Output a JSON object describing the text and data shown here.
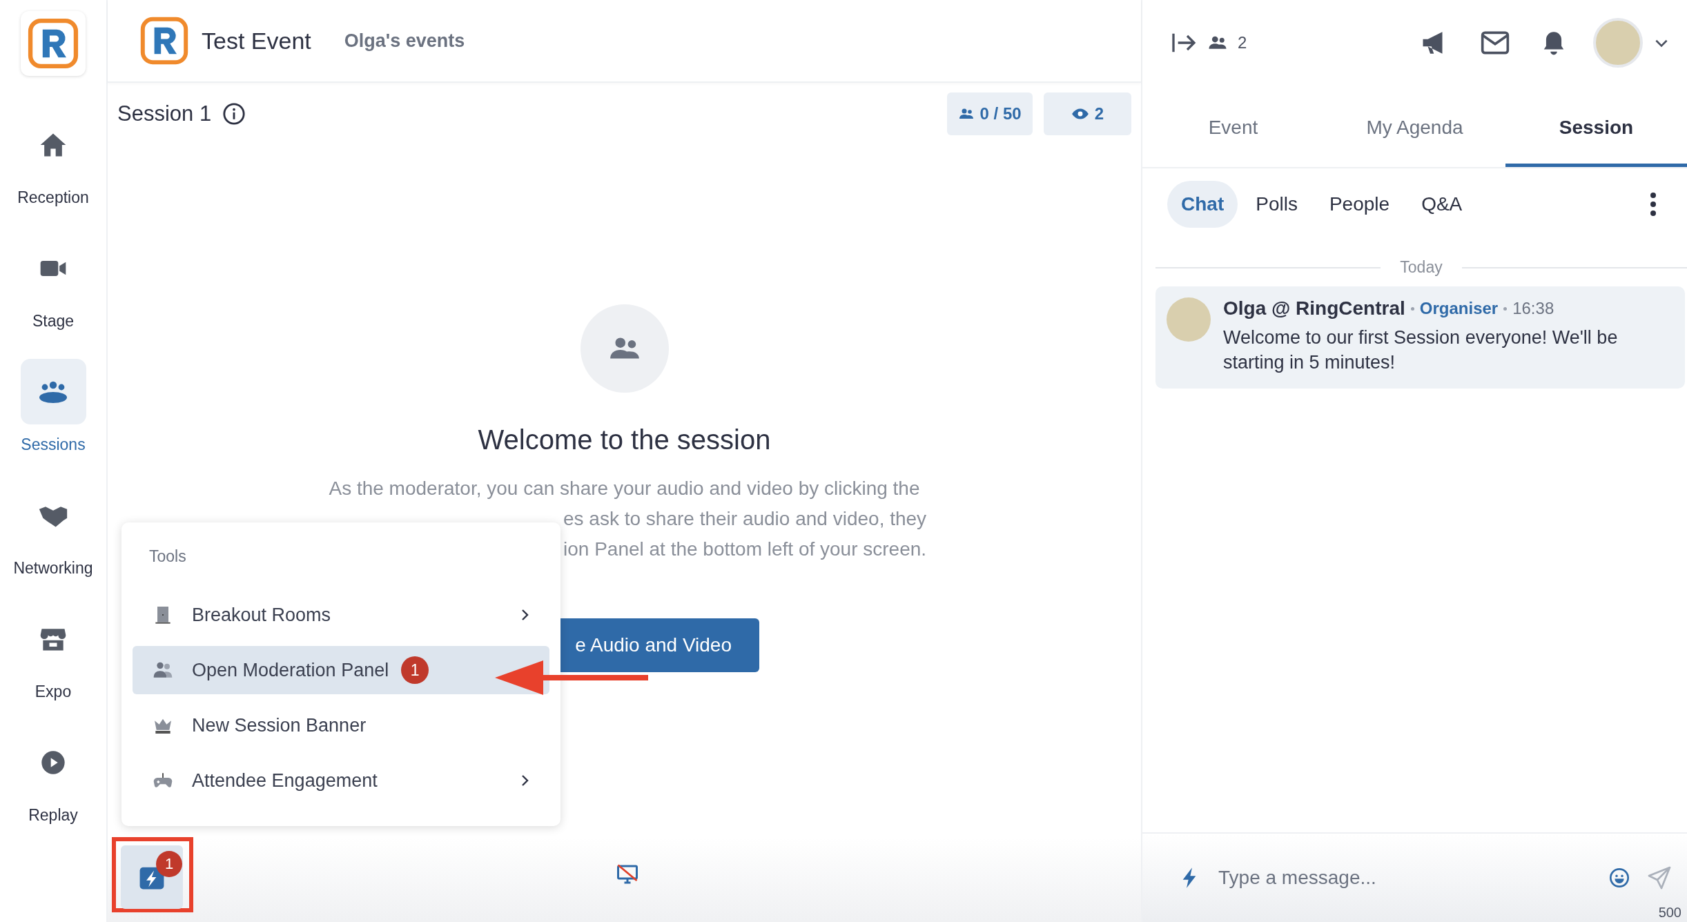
{
  "header": {
    "title": "Test Event",
    "subtitle": "Olga's events"
  },
  "sidebar": {
    "items": [
      {
        "label": "Reception",
        "selected": false
      },
      {
        "label": "Stage",
        "selected": false
      },
      {
        "label": "Sessions",
        "selected": true
      },
      {
        "label": "Networking",
        "selected": false
      },
      {
        "label": "Expo",
        "selected": false
      },
      {
        "label": "Replay",
        "selected": false
      }
    ]
  },
  "session": {
    "title": "Session 1",
    "capacity": "0 / 50",
    "viewers": "2"
  },
  "welcome": {
    "heading": "Welcome to the session",
    "lines": [
      "As the moderator, you can share your audio and video by clicking the",
      "es ask to share their audio and video, they",
      "ion Panel at the bottom left of your screen."
    ]
  },
  "primary_button": {
    "label": "e Audio and Video"
  },
  "tools_menu": {
    "title": "Tools",
    "items": [
      {
        "label": "Breakout Rooms",
        "selected": false,
        "submenu": true
      },
      {
        "label": "Open Moderation Panel",
        "selected": true,
        "submenu": false,
        "badge": "1"
      },
      {
        "label": "New Session Banner",
        "selected": false,
        "submenu": false
      },
      {
        "label": "Attendee Engagement",
        "selected": false,
        "submenu": true
      }
    ]
  },
  "tools_button": {
    "badge": "1"
  },
  "right_panel": {
    "online_count": "2",
    "tabs": [
      {
        "label": "Event",
        "selected": false
      },
      {
        "label": "My Agenda",
        "selected": false
      },
      {
        "label": "Session",
        "selected": true
      }
    ],
    "subtabs": [
      {
        "label": "Chat",
        "selected": true
      },
      {
        "label": "Polls",
        "selected": false
      },
      {
        "label": "People",
        "selected": false
      },
      {
        "label": "Q&A",
        "selected": false
      }
    ],
    "date_divider": "Today",
    "messages": [
      {
        "author": "Olga @ RingCentral",
        "role": "Organiser",
        "time": "16:38",
        "text": "Welcome to our first Session everyone! We'll be starting in 5 minutes!"
      }
    ],
    "composer": {
      "placeholder": "Type a message...",
      "char_limit": "500"
    }
  }
}
